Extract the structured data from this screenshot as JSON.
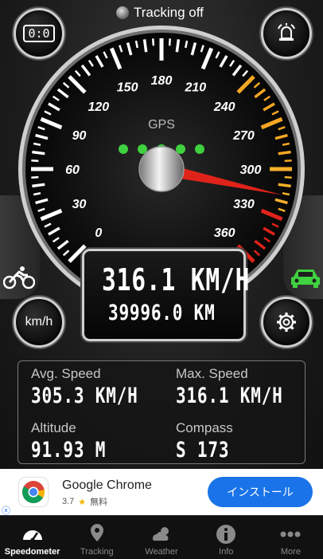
{
  "header": {
    "tracking_status": "Tracking off",
    "timer_icon_text": "0:0"
  },
  "gauge": {
    "label": "GPS",
    "unit": "km/h",
    "min": 0,
    "max": 360,
    "needle_value": 316.1,
    "tick_labels": [
      "0",
      "30",
      "60",
      "90",
      "120",
      "150",
      "180",
      "210",
      "240",
      "270",
      "300",
      "330",
      "360"
    ],
    "gps_dots": 5,
    "colors": {
      "gps": "#3fd13f",
      "needle": "#e0231a",
      "warn": "#f5a623",
      "danger": "#e0231a"
    }
  },
  "display": {
    "speed": "316.1 KM/H",
    "distance": "39996.0 KM"
  },
  "controls": {
    "unit_toggle": "km/h",
    "bike_icon": "cyclist-icon",
    "car_icon": "car-icon",
    "settings_icon": "gear-icon",
    "alarm_icon": "alarm-icon"
  },
  "stats": {
    "avg_label": "Avg. Speed",
    "avg_value": "305.3 KM/H",
    "max_label": "Max. Speed",
    "max_value": "316.1 KM/H",
    "alt_label": "Altitude",
    "alt_value": "91.93 M",
    "compass_label": "Compass",
    "compass_value": "S 173"
  },
  "ad": {
    "title": "Google Chrome",
    "rating": "3.7",
    "star": "★",
    "price": "無料",
    "install": "インストール",
    "info_icon": "ⓧ"
  },
  "tabs": [
    {
      "label": "Speedometer",
      "icon": "speedometer-icon"
    },
    {
      "label": "Tracking",
      "icon": "location-pin-icon"
    },
    {
      "label": "Weather",
      "icon": "weather-icon"
    },
    {
      "label": "Info",
      "icon": "info-icon"
    },
    {
      "label": "More",
      "icon": "more-icon"
    }
  ]
}
